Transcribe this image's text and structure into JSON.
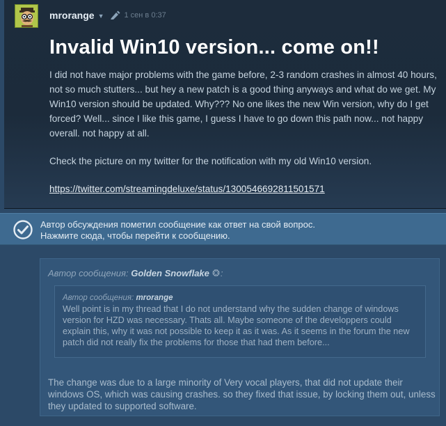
{
  "post": {
    "author": "mrorange",
    "date": "1 сен в 0:37",
    "title": "Invalid Win10 version... come on!!",
    "paragraph_1": "I did not have major problems with the game before, 2-3 random crashes in almost 40 hours, not so much stutters... but hey a new patch is a good thing anyways and what do we get. My Win10 version should be updated. Why??? No one likes the new Win version, why do I get forced? Well... since I like this game, I guess I have to go down this path now... not happy overall. not happy at all.",
    "paragraph_2": "Check the picture on my twitter for the notification with my old Win10 version.",
    "link": "https://twitter.com/streamingdeluxe/status/1300546692811501571",
    "icons": {
      "avatar": "avatar-glasses-mustache",
      "caret": "caret-down-icon",
      "edit": "edit-pen-icon"
    }
  },
  "answer_notice": {
    "line_1": "Автор обсуждения пометил сообщение как ответ на свой вопрос.",
    "line_2": "Нажмите сюда, чтобы перейти к сообщению.",
    "icon": "check-circle-icon"
  },
  "reply": {
    "author_prefix": "Автор сообщения:",
    "author_name": "Golden Snowflake",
    "author_suffix": ":",
    "nested_quote": {
      "author_prefix": "Автор сообщения:",
      "author_name": "mrorange",
      "text": "Well point is in my thread that I do not understand why the sudden change of windows version for HZD was necessary. Thats all. Maybe someone of the developpers could explain this, why it was not possible to keep it as it was. As it seems in the forum the new patch did not really fix the problems for those that had them before..."
    },
    "body": "The change was due to a large minority of Very vocal players, that did not update their windows OS, which was causing crashes. so they fixed that issue, by locking them out, unless they updated to supported software."
  },
  "colors": {
    "page_bg": "#2c4967",
    "post_bg": "#1c2b3b",
    "notice_bg": "#3e6a90",
    "reply_bg": "#335679"
  }
}
